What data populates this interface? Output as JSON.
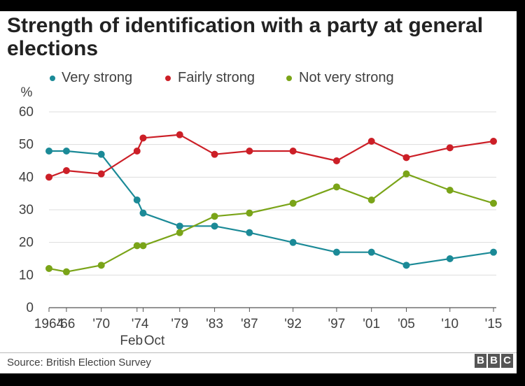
{
  "title": "Strength of identification with a party at general elections",
  "source": "Source: British Election Survey",
  "logo": {
    "letters": [
      "B",
      "B",
      "C"
    ]
  },
  "chart_data": {
    "type": "line",
    "title": "Strength of identification with a party at general elections",
    "ylabel": "%",
    "xlabel": "",
    "ylim": [
      0,
      60
    ],
    "yticks": [
      0,
      10,
      20,
      30,
      40,
      50,
      60
    ],
    "x": [
      1964,
      1966,
      1970,
      1974.1,
      1974.8,
      1979,
      1983,
      1987,
      1992,
      1997,
      2001,
      2005,
      2010,
      2015
    ],
    "xticks": [
      {
        "x": 1964,
        "label": "1964"
      },
      {
        "x": 1966,
        "label": "'66"
      },
      {
        "x": 1970,
        "label": "'70"
      },
      {
        "x": 1974.45,
        "label": "'74"
      },
      {
        "x": 1979,
        "label": "'79"
      },
      {
        "x": 1983,
        "label": "'83"
      },
      {
        "x": 1987,
        "label": "'87"
      },
      {
        "x": 1992,
        "label": "'92"
      },
      {
        "x": 1997,
        "label": "'97"
      },
      {
        "x": 2001,
        "label": "'01"
      },
      {
        "x": 2005,
        "label": "'05"
      },
      {
        "x": 2010,
        "label": "'10"
      },
      {
        "x": 2015,
        "label": "'15"
      }
    ],
    "sublabels": [
      {
        "x": 1974.1,
        "label": "Feb"
      },
      {
        "x": 1974.8,
        "label": "Oct"
      }
    ],
    "grid": true,
    "legend_position": "top",
    "series": [
      {
        "name": "Very strong",
        "color": "#1b8a97",
        "values": [
          48,
          48,
          47,
          33,
          29,
          25,
          25,
          23,
          20,
          17,
          17,
          13,
          15,
          17
        ]
      },
      {
        "name": "Fairly strong",
        "color": "#cc1f27",
        "values": [
          40,
          42,
          41,
          48,
          52,
          53,
          47,
          48,
          48,
          45,
          51,
          46,
          49,
          51
        ]
      },
      {
        "name": "Not very strong",
        "color": "#7aa418",
        "values": [
          12,
          11,
          13,
          19,
          19,
          23,
          28,
          29,
          32,
          37,
          33,
          41,
          36,
          32
        ]
      }
    ]
  }
}
